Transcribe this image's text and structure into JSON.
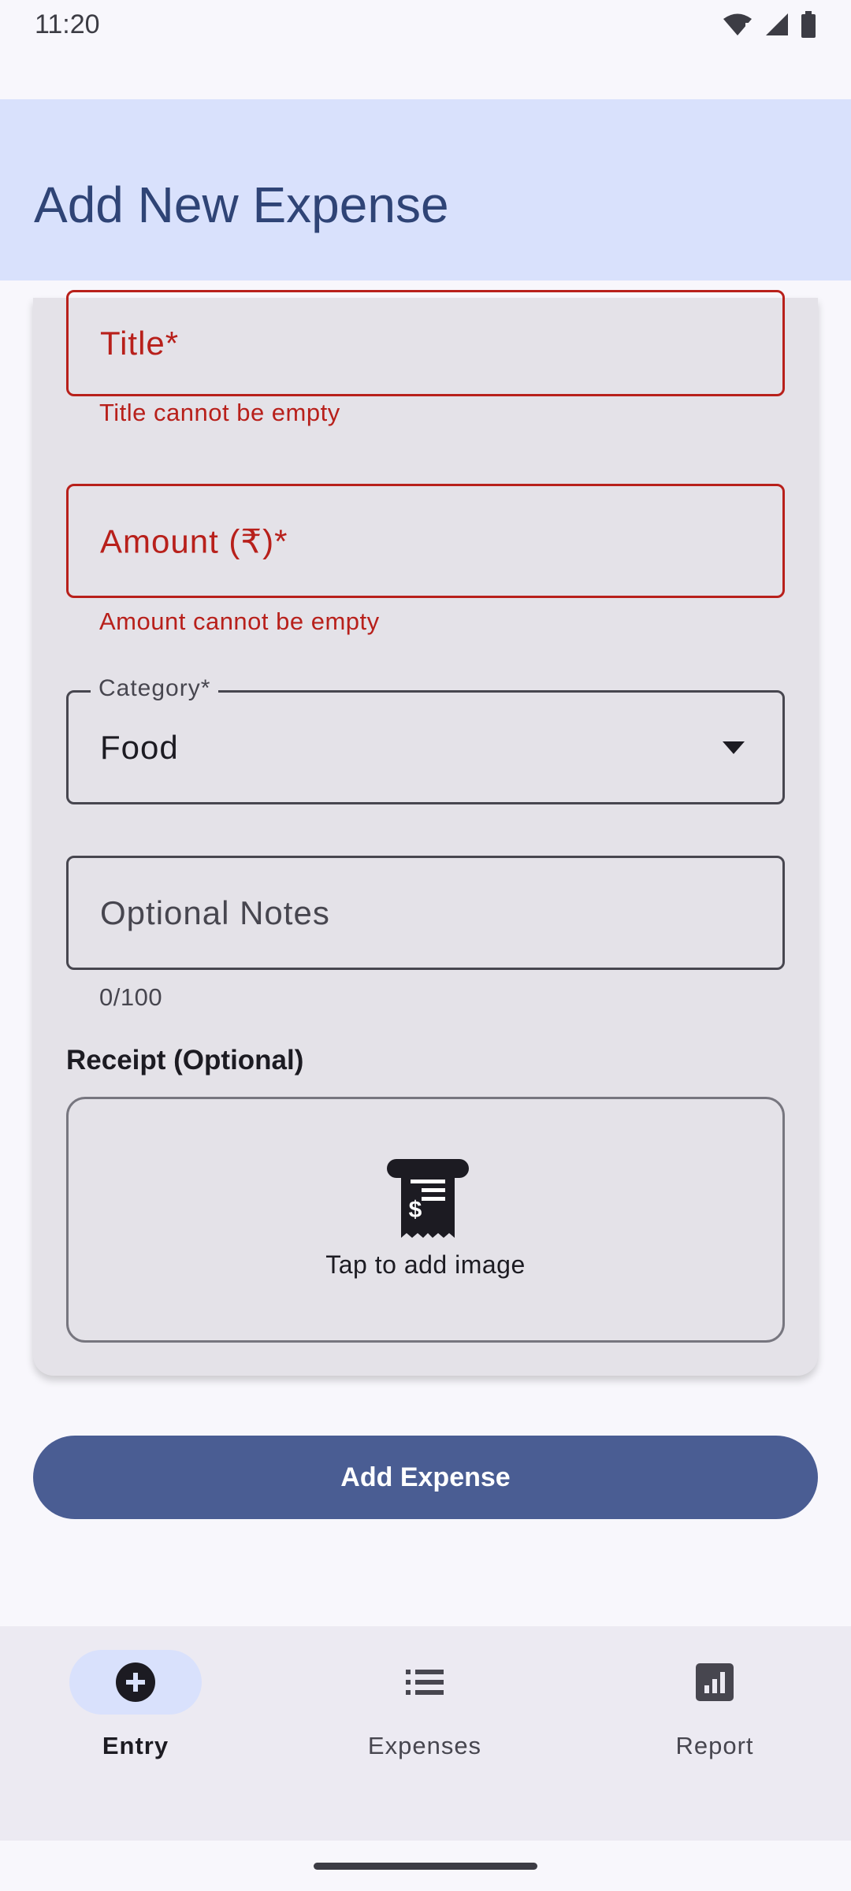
{
  "status_bar": {
    "time": "11:20"
  },
  "app_bar": {
    "title": "Add New Expense"
  },
  "form": {
    "title_field": {
      "label": "Title*",
      "error": "Title cannot be empty"
    },
    "amount_field": {
      "label": "Amount (₹)*",
      "error": "Amount cannot be empty"
    },
    "category_field": {
      "label": "Category*",
      "value": "Food"
    },
    "notes_field": {
      "placeholder": "Optional Notes",
      "counter": "0/100"
    },
    "receipt": {
      "section_label": "Receipt (Optional)",
      "action_text": "Tap to add image"
    }
  },
  "submit_button": {
    "label": "Add Expense"
  },
  "bottom_nav": {
    "items": [
      {
        "label": "Entry",
        "icon": "add-circle-icon",
        "selected": true
      },
      {
        "label": "Expenses",
        "icon": "list-icon",
        "selected": false
      },
      {
        "label": "Report",
        "icon": "bar-chart-icon",
        "selected": false
      }
    ]
  },
  "colors": {
    "accent": "#4a5d93",
    "app_bar": "#d9e1fc",
    "error": "#b8201b",
    "surface": "#e4e2e8"
  }
}
